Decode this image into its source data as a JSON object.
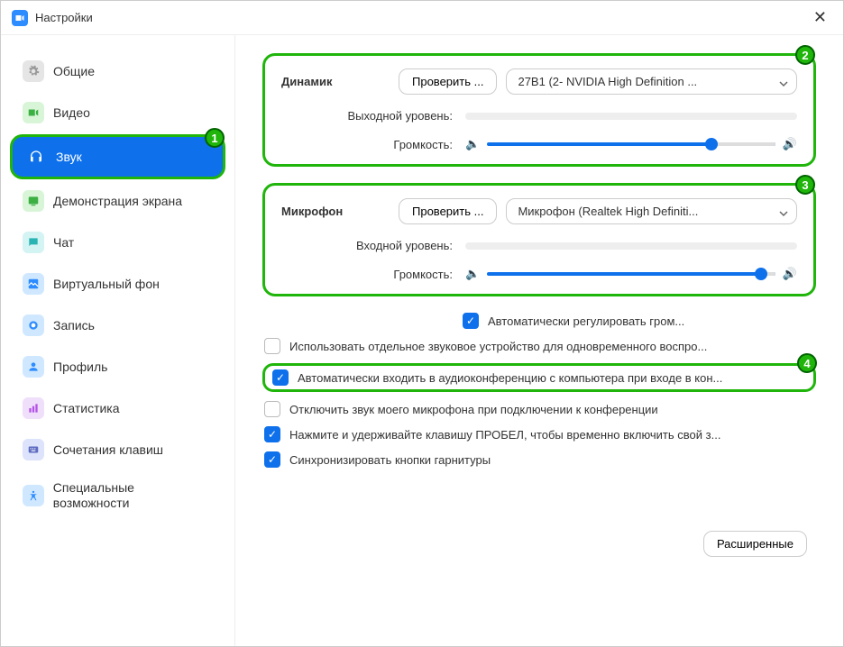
{
  "titlebar": {
    "title": "Настройки"
  },
  "sidebar": {
    "items": [
      {
        "label": "Общие",
        "iconColor": "#e5e5e5"
      },
      {
        "label": "Видео",
        "iconColor": "#d8f5d8"
      },
      {
        "label": "Звук",
        "iconColor": "#ffffff",
        "active": true
      },
      {
        "label": "Демонстрация экрана",
        "iconColor": "#d8f5d8"
      },
      {
        "label": "Чат",
        "iconColor": "#d4f3f3"
      },
      {
        "label": "Виртуальный фон",
        "iconColor": "#d0e8ff"
      },
      {
        "label": "Запись",
        "iconColor": "#d0e8ff"
      },
      {
        "label": "Профиль",
        "iconColor": "#d0e8ff"
      },
      {
        "label": "Статистика",
        "iconColor": "#f0dffb"
      },
      {
        "label": "Сочетания клавиш",
        "iconColor": "#dce3fb"
      },
      {
        "label": "Специальные возможности",
        "iconColor": "#d0e8ff"
      }
    ]
  },
  "speaker": {
    "title": "Динамик",
    "test_btn": "Проверить ...",
    "device": "27B1 (2- NVIDIA High Definition ...",
    "output_level_label": "Выходной уровень:",
    "volume_label": "Громкость:",
    "volume_pct": 78
  },
  "mic": {
    "title": "Микрофон",
    "test_btn": "Проверить ...",
    "device": "Микрофон (Realtek High Definiti...",
    "input_level_label": "Входной уровень:",
    "volume_label": "Громкость:",
    "volume_pct": 95,
    "auto_adjust_label": "Автоматически регулировать гром..."
  },
  "options": {
    "separate_device": "Использовать отдельное звуковое устройство для одновременного воспро...",
    "auto_join_audio": "Автоматически входить в аудиоконференцию с компьютера при входе в кон...",
    "mute_on_join": "Отключить звук моего микрофона при подключении к конференции",
    "push_to_talk": "Нажмите и удерживайте клавишу ПРОБЕЛ, чтобы временно включить свой з...",
    "sync_headset": "Синхронизировать кнопки гарнитуры"
  },
  "footer": {
    "advanced": "Расширенные"
  },
  "annotations": {
    "a1": "1",
    "a2": "2",
    "a3": "3",
    "a4": "4"
  }
}
